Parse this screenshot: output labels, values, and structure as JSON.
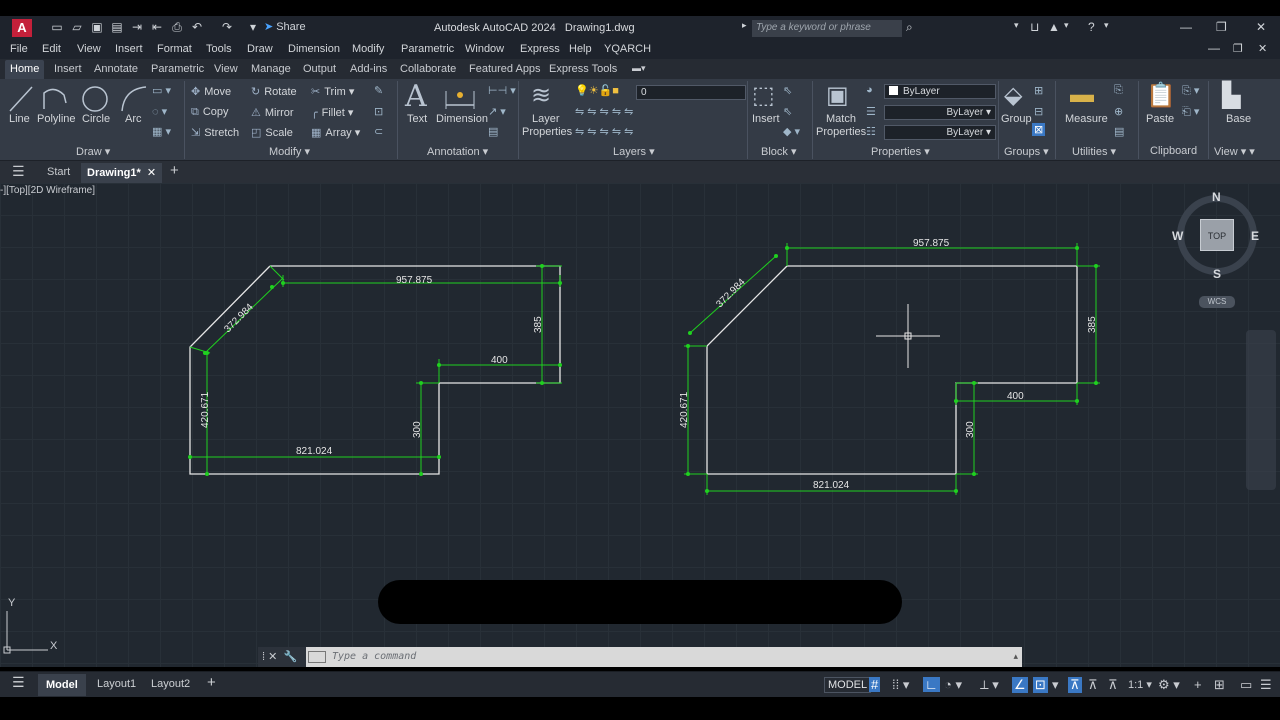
{
  "title_bar": {
    "logo": "A",
    "share": "Share",
    "app_title": "Autodesk AutoCAD 2024",
    "file_name": "Drawing1.dwg",
    "search_placeholder": "Type a keyword or phrase"
  },
  "menu": [
    "File",
    "Edit",
    "View",
    "Insert",
    "Format",
    "Tools",
    "Draw",
    "Dimension",
    "Modify",
    "Parametric",
    "Window",
    "Express",
    "Help",
    "YQARCH"
  ],
  "ribbon_tabs": [
    "Home",
    "Insert",
    "Annotate",
    "Parametric",
    "View",
    "Manage",
    "Output",
    "Add-ins",
    "Collaborate",
    "Featured Apps",
    "Express Tools"
  ],
  "ribbon": {
    "draw": {
      "line": "Line",
      "polyline": "Polyline",
      "circle": "Circle",
      "arc": "Arc",
      "footer": "Draw"
    },
    "modify": {
      "move": "Move",
      "copy": "Copy",
      "stretch": "Stretch",
      "rotate": "Rotate",
      "mirror": "Mirror",
      "scale": "Scale",
      "trim": "Trim",
      "fillet": "Fillet",
      "array": "Array",
      "footer": "Modify"
    },
    "annotation": {
      "text": "Text",
      "dimension": "Dimension",
      "footer": "Annotation"
    },
    "layers": {
      "layer_line1": "Layer",
      "layer_line2": "Properties",
      "current_layer": "0",
      "footer": "Layers"
    },
    "block": {
      "insert": "Insert",
      "footer": "Block"
    },
    "properties": {
      "match_line1": "Match",
      "match_line2": "Properties",
      "color": "ByLayer",
      "linetype": "ByLayer",
      "lineweight": "ByLayer",
      "footer": "Properties"
    },
    "groups": {
      "group": "Group",
      "footer": "Groups"
    },
    "utilities": {
      "measure": "Measure",
      "footer": "Utilities"
    },
    "clipboard": {
      "paste": "Paste",
      "footer": "Clipboard"
    },
    "view": {
      "base": "Base",
      "footer": "View"
    }
  },
  "file_tabs": {
    "start": "Start",
    "current": "Drawing1*"
  },
  "viewport_label": "-][Top][2D Wireframe]",
  "view_cube": {
    "top": "TOP",
    "n": "N",
    "s": "S",
    "e": "E",
    "w": "W",
    "wcs": "WCS"
  },
  "ucs": {
    "x": "X",
    "y": "Y"
  },
  "dimensions": {
    "top": "957.875",
    "diagonal": "372.984",
    "right": "385",
    "step": "400",
    "inner": "300",
    "left": "420.671",
    "bottom": "821.024"
  },
  "command_placeholder": "Type a command",
  "layout_tabs": [
    "Model",
    "Layout1",
    "Layout2"
  ],
  "status": {
    "model": "MODEL",
    "scale": "1:1"
  },
  "colors": {
    "dim_green": "#1fd11f",
    "geometry_white": "#e6e6e6",
    "canvas": "#212830",
    "ribbon": "#343b46"
  }
}
